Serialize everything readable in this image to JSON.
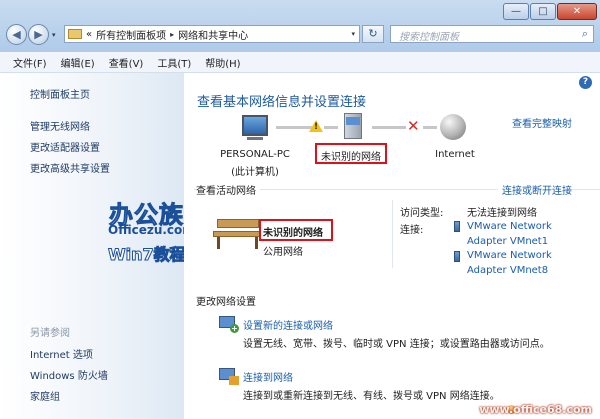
{
  "window": {
    "minimize_glyph": "—",
    "maximize_glyph": "□",
    "close_glyph": "✕"
  },
  "address_bar": {
    "overflow": "«",
    "crumbs": [
      "所有控制面板项",
      "网络和共享中心"
    ],
    "separator": "▸",
    "dropdown": "▾",
    "refresh_glyph": "↻"
  },
  "nav": {
    "back": "◀",
    "forward": "▶",
    "history": "▾"
  },
  "search": {
    "placeholder": "搜索控制面板",
    "icon": "search-icon",
    "icon_glyph": "⌕"
  },
  "menu": [
    "文件(F)",
    "编辑(E)",
    "查看(V)",
    "工具(T)",
    "帮助(H)"
  ],
  "sidebar": {
    "home": "控制面板主页",
    "links": [
      "管理无线网络",
      "更改适配器设置",
      "更改高级共享设置"
    ],
    "see_also_title": "另请参阅",
    "see_also": [
      "Internet 选项",
      "Windows 防火墙",
      "家庭组"
    ]
  },
  "logo": {
    "main": "办公族",
    "site": "Officezu.com",
    "sub": "Win7教程"
  },
  "main": {
    "help_glyph": "?",
    "title": "查看基本网络信息并设置连接",
    "full_map_link": "查看完整映射",
    "map_nodes": {
      "pc_name": "PERSONAL-PC",
      "pc_sub": "(此计算机)",
      "network": "未识别的网络",
      "internet": "Internet"
    },
    "warning_glyph": "!",
    "error_glyph": "✕",
    "active_title": "查看活动网络",
    "connect_link": "连接或断开连接",
    "active_network": {
      "name": "未识别的网络",
      "type": "公用网络",
      "access_label": "访问类型:",
      "access_value": "无法连接到网络",
      "conn_label": "连接:",
      "adapters": [
        [
          "VMware Network",
          "Adapter VMnet1"
        ],
        [
          "VMware Network",
          "Adapter VMnet8"
        ]
      ]
    },
    "change_title": "更改网络设置",
    "tasks": [
      {
        "link": "设置新的连接或网络",
        "desc": "设置无线、宽带、拨号、临时或 VPN 连接；或设置路由器或访问点。",
        "plus_glyph": "+"
      },
      {
        "link": "连接到网络",
        "desc": "连接到或重新连接到无线、有线、拨号或 VPN 网络连接。"
      }
    ]
  },
  "watermark": "www.office68.com",
  "colors": {
    "link": "#1a5dab",
    "title": "#1e5aa0",
    "highlight_box": "#e0101a",
    "logo_blue": "#1b4f9a"
  }
}
